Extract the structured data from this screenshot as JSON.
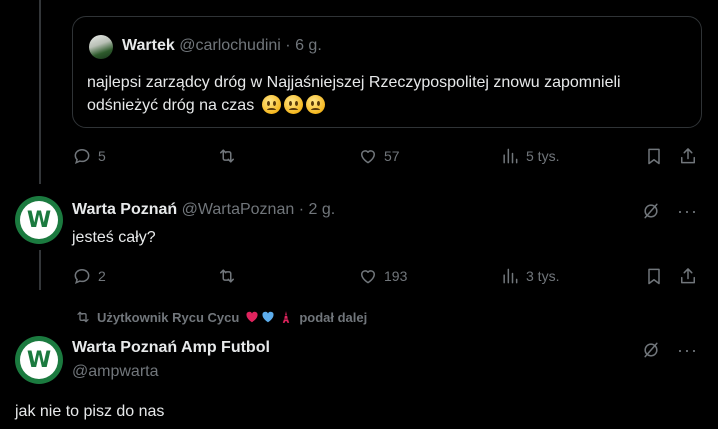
{
  "colors": {
    "background": "#000000",
    "text": "#e7e9ea",
    "muted": "#71767b",
    "border": "#2f3336",
    "club_green": "#1b7a3f"
  },
  "quote": {
    "author_name": "Wartek",
    "handle": "@carlochudini",
    "dot": "·",
    "time": "6 g.",
    "text": "najlepsi zarządcy dróg w Najjaśniejszej Rzeczypospolitej znowu zapomnieli odśnieżyć dróg na czas"
  },
  "tweet1_actions": {
    "replies": "5",
    "retweets": "",
    "likes": "57",
    "views": "5 tys."
  },
  "reply": {
    "author_name": "Warta Poznań",
    "handle": "@WartaPoznan",
    "dot": "·",
    "time": "2 g.",
    "text": "jesteś cały?",
    "avatar_letter": "W"
  },
  "reply_actions": {
    "replies": "2",
    "retweets": "",
    "likes": "193",
    "views": "3 tys."
  },
  "repost_banner": {
    "text_prefix": "Użytkownik Rycu Cycu",
    "text_suffix": "podał dalej"
  },
  "last_post": {
    "author_name": "Warta Poznań Amp Futbol",
    "handle": "@ampwarta",
    "text": "jak nie to pisz do nas",
    "avatar_letter": "W"
  },
  "icons": [
    "reply-icon",
    "retweet-icon",
    "like-icon",
    "views-icon",
    "bookmark-icon",
    "share-icon",
    "grok-icon",
    "more-icon"
  ]
}
